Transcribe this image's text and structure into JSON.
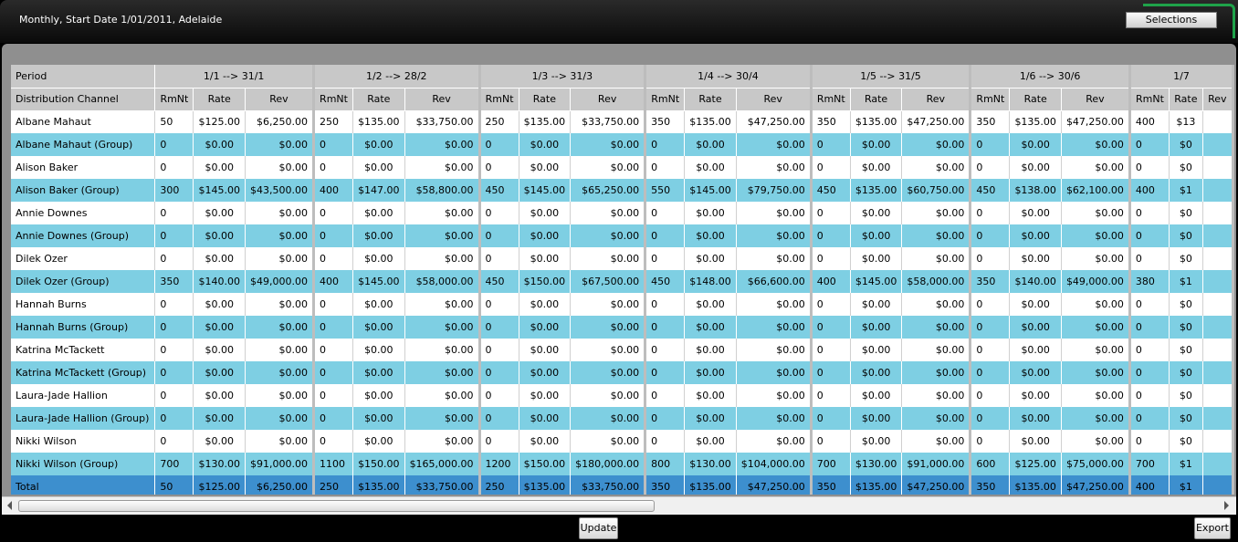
{
  "header": {
    "title": "Monthly, Start Date 1/01/2011, Adelaide",
    "selections_label": "Selections"
  },
  "table": {
    "period_label": "Period",
    "channel_label": "Distribution Channel",
    "subcolumns": [
      "RmNt",
      "Rate",
      "Rev"
    ],
    "periods": [
      "1/1 --> 31/1",
      "1/2 --> 28/2",
      "1/3 --> 31/3",
      "1/4 --> 30/4",
      "1/5 --> 31/5",
      "1/6 --> 30/6",
      "1/7"
    ],
    "rows": [
      {
        "name": "Albane Mahaut",
        "style": "white",
        "cells": [
          [
            "50",
            "$125.00",
            "$6,250.00"
          ],
          [
            "250",
            "$135.00",
            "$33,750.00"
          ],
          [
            "250",
            "$135.00",
            "$33,750.00"
          ],
          [
            "350",
            "$135.00",
            "$47,250.00"
          ],
          [
            "350",
            "$135.00",
            "$47,250.00"
          ],
          [
            "350",
            "$135.00",
            "$47,250.00"
          ],
          [
            "400",
            "$13",
            ""
          ]
        ]
      },
      {
        "name": "Albane Mahaut (Group)",
        "style": "blue",
        "cells": [
          [
            "0",
            "$0.00",
            "$0.00"
          ],
          [
            "0",
            "$0.00",
            "$0.00"
          ],
          [
            "0",
            "$0.00",
            "$0.00"
          ],
          [
            "0",
            "$0.00",
            "$0.00"
          ],
          [
            "0",
            "$0.00",
            "$0.00"
          ],
          [
            "0",
            "$0.00",
            "$0.00"
          ],
          [
            "0",
            "$0",
            ""
          ]
        ]
      },
      {
        "name": "Alison Baker",
        "style": "white",
        "cells": [
          [
            "0",
            "$0.00",
            "$0.00"
          ],
          [
            "0",
            "$0.00",
            "$0.00"
          ],
          [
            "0",
            "$0.00",
            "$0.00"
          ],
          [
            "0",
            "$0.00",
            "$0.00"
          ],
          [
            "0",
            "$0.00",
            "$0.00"
          ],
          [
            "0",
            "$0.00",
            "$0.00"
          ],
          [
            "0",
            "$0",
            ""
          ]
        ]
      },
      {
        "name": "Alison Baker (Group)",
        "style": "blue",
        "cells": [
          [
            "300",
            "$145.00",
            "$43,500.00"
          ],
          [
            "400",
            "$147.00",
            "$58,800.00"
          ],
          [
            "450",
            "$145.00",
            "$65,250.00"
          ],
          [
            "550",
            "$145.00",
            "$79,750.00"
          ],
          [
            "450",
            "$135.00",
            "$60,750.00"
          ],
          [
            "450",
            "$138.00",
            "$62,100.00"
          ],
          [
            "400",
            "$1",
            ""
          ]
        ]
      },
      {
        "name": "Annie Downes",
        "style": "white",
        "cells": [
          [
            "0",
            "$0.00",
            "$0.00"
          ],
          [
            "0",
            "$0.00",
            "$0.00"
          ],
          [
            "0",
            "$0.00",
            "$0.00"
          ],
          [
            "0",
            "$0.00",
            "$0.00"
          ],
          [
            "0",
            "$0.00",
            "$0.00"
          ],
          [
            "0",
            "$0.00",
            "$0.00"
          ],
          [
            "0",
            "$0",
            ""
          ]
        ]
      },
      {
        "name": "Annie Downes (Group)",
        "style": "blue",
        "cells": [
          [
            "0",
            "$0.00",
            "$0.00"
          ],
          [
            "0",
            "$0.00",
            "$0.00"
          ],
          [
            "0",
            "$0.00",
            "$0.00"
          ],
          [
            "0",
            "$0.00",
            "$0.00"
          ],
          [
            "0",
            "$0.00",
            "$0.00"
          ],
          [
            "0",
            "$0.00",
            "$0.00"
          ],
          [
            "0",
            "$0",
            ""
          ]
        ]
      },
      {
        "name": "Dilek Ozer",
        "style": "white",
        "cells": [
          [
            "0",
            "$0.00",
            "$0.00"
          ],
          [
            "0",
            "$0.00",
            "$0.00"
          ],
          [
            "0",
            "$0.00",
            "$0.00"
          ],
          [
            "0",
            "$0.00",
            "$0.00"
          ],
          [
            "0",
            "$0.00",
            "$0.00"
          ],
          [
            "0",
            "$0.00",
            "$0.00"
          ],
          [
            "0",
            "$0",
            ""
          ]
        ]
      },
      {
        "name": "Dilek Ozer (Group)",
        "style": "blue",
        "cells": [
          [
            "350",
            "$140.00",
            "$49,000.00"
          ],
          [
            "400",
            "$145.00",
            "$58,000.00"
          ],
          [
            "450",
            "$150.00",
            "$67,500.00"
          ],
          [
            "450",
            "$148.00",
            "$66,600.00"
          ],
          [
            "400",
            "$145.00",
            "$58,000.00"
          ],
          [
            "350",
            "$140.00",
            "$49,000.00"
          ],
          [
            "380",
            "$1",
            ""
          ]
        ]
      },
      {
        "name": "Hannah Burns",
        "style": "white",
        "cells": [
          [
            "0",
            "$0.00",
            "$0.00"
          ],
          [
            "0",
            "$0.00",
            "$0.00"
          ],
          [
            "0",
            "$0.00",
            "$0.00"
          ],
          [
            "0",
            "$0.00",
            "$0.00"
          ],
          [
            "0",
            "$0.00",
            "$0.00"
          ],
          [
            "0",
            "$0.00",
            "$0.00"
          ],
          [
            "0",
            "$0",
            ""
          ]
        ]
      },
      {
        "name": "Hannah Burns  (Group)",
        "style": "blue",
        "cells": [
          [
            "0",
            "$0.00",
            "$0.00"
          ],
          [
            "0",
            "$0.00",
            "$0.00"
          ],
          [
            "0",
            "$0.00",
            "$0.00"
          ],
          [
            "0",
            "$0.00",
            "$0.00"
          ],
          [
            "0",
            "$0.00",
            "$0.00"
          ],
          [
            "0",
            "$0.00",
            "$0.00"
          ],
          [
            "0",
            "$0",
            ""
          ]
        ]
      },
      {
        "name": "Katrina McTackett",
        "style": "white",
        "cells": [
          [
            "0",
            "$0.00",
            "$0.00"
          ],
          [
            "0",
            "$0.00",
            "$0.00"
          ],
          [
            "0",
            "$0.00",
            "$0.00"
          ],
          [
            "0",
            "$0.00",
            "$0.00"
          ],
          [
            "0",
            "$0.00",
            "$0.00"
          ],
          [
            "0",
            "$0.00",
            "$0.00"
          ],
          [
            "0",
            "$0",
            ""
          ]
        ]
      },
      {
        "name": "Katrina McTackett (Group)",
        "style": "blue",
        "cells": [
          [
            "0",
            "$0.00",
            "$0.00"
          ],
          [
            "0",
            "$0.00",
            "$0.00"
          ],
          [
            "0",
            "$0.00",
            "$0.00"
          ],
          [
            "0",
            "$0.00",
            "$0.00"
          ],
          [
            "0",
            "$0.00",
            "$0.00"
          ],
          [
            "0",
            "$0.00",
            "$0.00"
          ],
          [
            "0",
            "$0",
            ""
          ]
        ]
      },
      {
        "name": "Laura-Jade Hallion",
        "style": "white",
        "cells": [
          [
            "0",
            "$0.00",
            "$0.00"
          ],
          [
            "0",
            "$0.00",
            "$0.00"
          ],
          [
            "0",
            "$0.00",
            "$0.00"
          ],
          [
            "0",
            "$0.00",
            "$0.00"
          ],
          [
            "0",
            "$0.00",
            "$0.00"
          ],
          [
            "0",
            "$0.00",
            "$0.00"
          ],
          [
            "0",
            "$0",
            ""
          ]
        ]
      },
      {
        "name": "Laura-Jade Hallion (Group)",
        "style": "blue",
        "cells": [
          [
            "0",
            "$0.00",
            "$0.00"
          ],
          [
            "0",
            "$0.00",
            "$0.00"
          ],
          [
            "0",
            "$0.00",
            "$0.00"
          ],
          [
            "0",
            "$0.00",
            "$0.00"
          ],
          [
            "0",
            "$0.00",
            "$0.00"
          ],
          [
            "0",
            "$0.00",
            "$0.00"
          ],
          [
            "0",
            "$0",
            ""
          ]
        ]
      },
      {
        "name": "Nikki Wilson",
        "style": "white",
        "cells": [
          [
            "0",
            "$0.00",
            "$0.00"
          ],
          [
            "0",
            "$0.00",
            "$0.00"
          ],
          [
            "0",
            "$0.00",
            "$0.00"
          ],
          [
            "0",
            "$0.00",
            "$0.00"
          ],
          [
            "0",
            "$0.00",
            "$0.00"
          ],
          [
            "0",
            "$0.00",
            "$0.00"
          ],
          [
            "0",
            "$0",
            ""
          ]
        ]
      },
      {
        "name": "Nikki Wilson (Group)",
        "style": "blue",
        "cells": [
          [
            "700",
            "$130.00",
            "$91,000.00"
          ],
          [
            "1100",
            "$150.00",
            "$165,000.00"
          ],
          [
            "1200",
            "$150.00",
            "$180,000.00"
          ],
          [
            "800",
            "$130.00",
            "$104,000.00"
          ],
          [
            "700",
            "$130.00",
            "$91,000.00"
          ],
          [
            "600",
            "$125.00",
            "$75,000.00"
          ],
          [
            "700",
            "$1",
            ""
          ]
        ]
      },
      {
        "name": "Total",
        "style": "total",
        "cells": [
          [
            "50",
            "$125.00",
            "$6,250.00"
          ],
          [
            "250",
            "$135.00",
            "$33,750.00"
          ],
          [
            "250",
            "$135.00",
            "$33,750.00"
          ],
          [
            "350",
            "$135.00",
            "$47,250.00"
          ],
          [
            "350",
            "$135.00",
            "$47,250.00"
          ],
          [
            "350",
            "$135.00",
            "$47,250.00"
          ],
          [
            "400",
            "$1",
            ""
          ]
        ]
      }
    ]
  },
  "footer": {
    "update_label": "Update",
    "export_label": "Export"
  }
}
